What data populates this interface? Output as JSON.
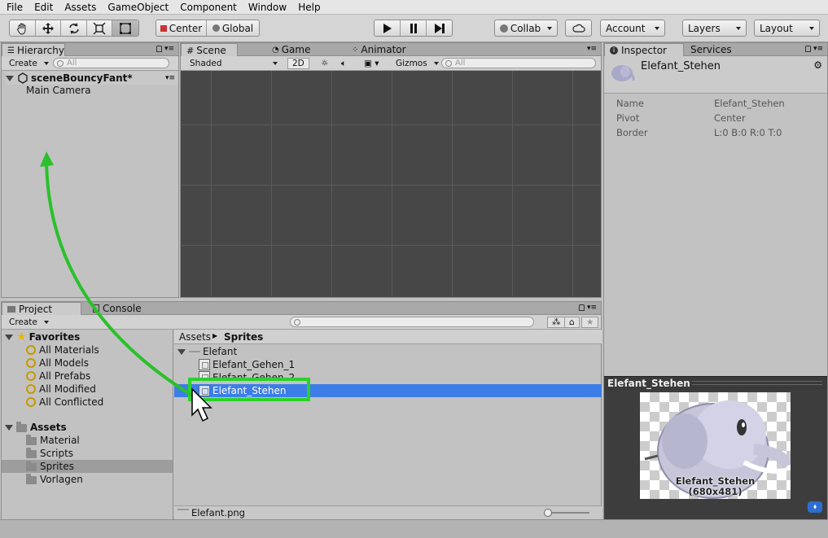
{
  "menu": [
    "File",
    "Edit",
    "Assets",
    "GameObject",
    "Component",
    "Window",
    "Help"
  ],
  "toolbar": {
    "pivot_mode": "Center",
    "pivot_space": "Global",
    "collab": "Collab",
    "account": "Account",
    "layers": "Layers",
    "layout": "Layout"
  },
  "hierarchy": {
    "tab": "Hierarchy",
    "create": "Create",
    "search_placeholder": "All",
    "scene_name": "sceneBouncyFant*",
    "items": [
      "Main Camera"
    ]
  },
  "scene": {
    "tabs": [
      "Scene",
      "Game",
      "Animator"
    ],
    "shading": "Shaded",
    "mode_2d": "2D",
    "gizmos": "Gizmos",
    "search_placeholder": "All"
  },
  "project": {
    "tabs": [
      "Project",
      "Console"
    ],
    "create": "Create",
    "favorites_label": "Favorites",
    "favorites": [
      "All Materials",
      "All Models",
      "All Prefabs",
      "All Modified",
      "All Conflicted"
    ],
    "assets_label": "Assets",
    "folders": [
      "Material",
      "Scripts",
      "Sprites",
      "Vorlagen"
    ],
    "selected_folder": "Sprites",
    "breadcrumb": [
      "Assets",
      "Sprites"
    ],
    "group": "Elefant",
    "files": [
      "Elefant_Gehen_1",
      "Elefant_Gehen_2",
      "Elefant_Stehen"
    ],
    "selected_file": "Elefant_Stehen",
    "footer_path": "Elefant.png",
    "zoom_level": 0.1
  },
  "inspector": {
    "tabs": [
      "Inspector",
      "Services"
    ],
    "object_name": "Elefant_Stehen",
    "properties": [
      {
        "key": "Name",
        "value": "Elefant_Stehen"
      },
      {
        "key": "Pivot",
        "value": "Center"
      },
      {
        "key": "Border",
        "value": "L:0 B:0 R:0 T:0"
      }
    ],
    "preview_title": "Elefant_Stehen",
    "preview_label": "Elefant_Stehen",
    "preview_size": "(680x481)"
  },
  "colors": {
    "selection": "#3d7de8",
    "highlight_box": "#2bd12b",
    "arrow": "#2bc02b"
  }
}
